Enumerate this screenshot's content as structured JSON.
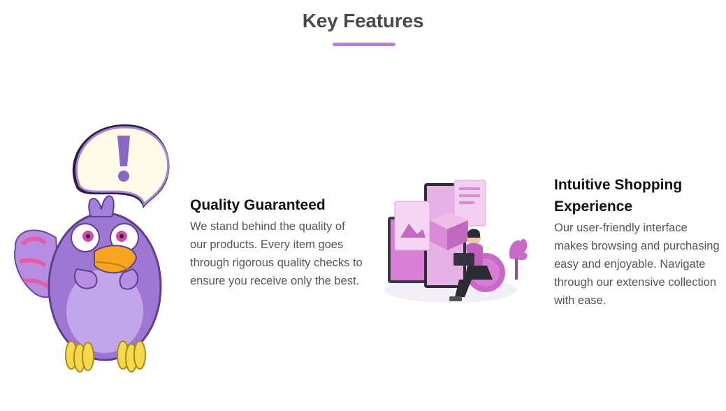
{
  "section": {
    "title": "Key Features",
    "accent_color": "#b67fdc"
  },
  "features": [
    {
      "title": "Quality Guaranteed",
      "text": "We stand behind the quality of our products. Every item goes through rigorous quality checks to ensure you receive only the best.",
      "illustration": "purple-bird-exclamation-illustration"
    },
    {
      "title": "Intuitive Shopping Experience",
      "text": "Our user-friendly interface makes browsing and purchasing easy and enjoyable. Navigate through our extensive collection with ease.",
      "illustration": "online-shopping-person-laptop-illustration"
    }
  ]
}
